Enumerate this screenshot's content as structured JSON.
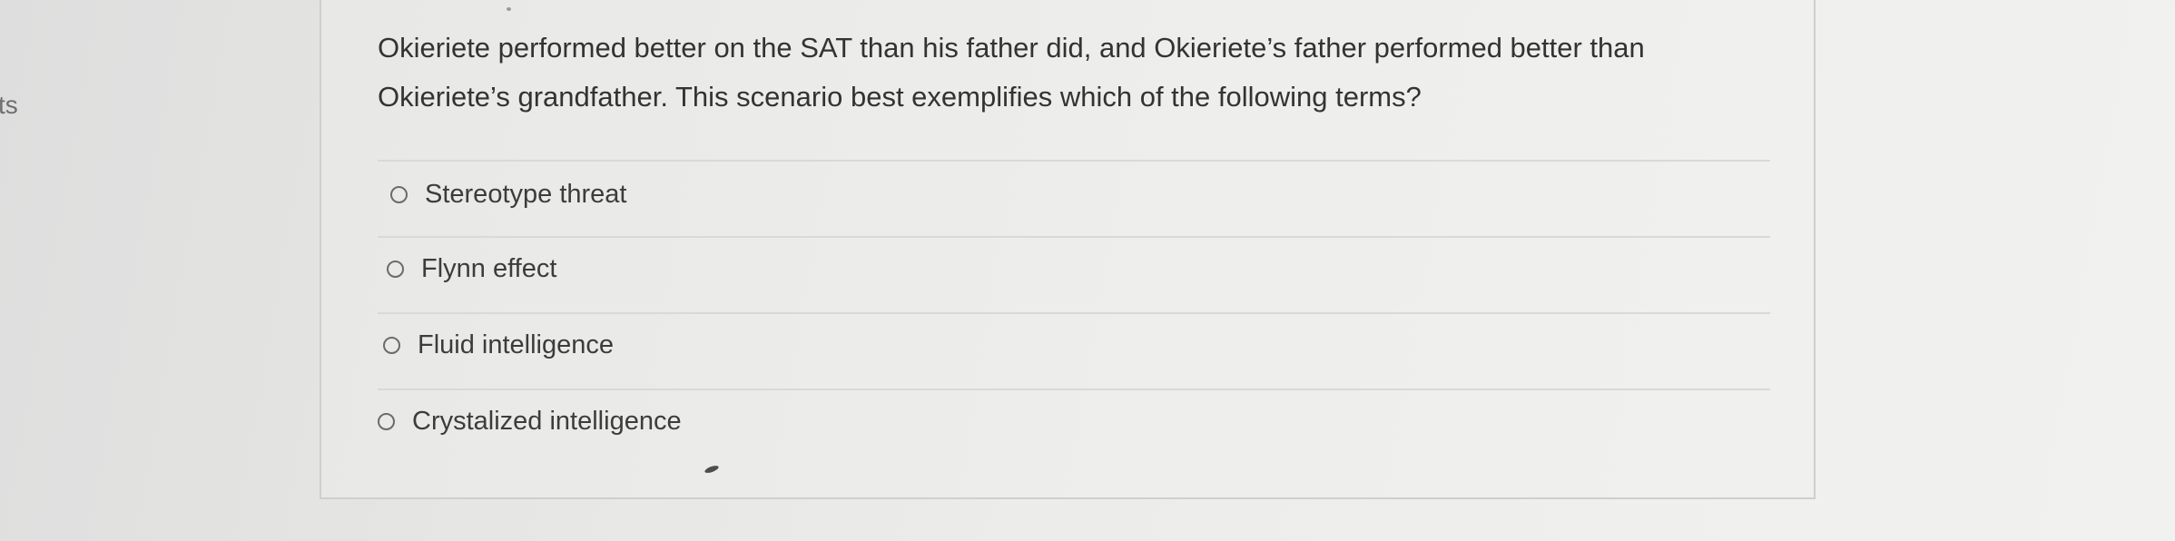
{
  "sidebar": {
    "cut_off_label": "ts"
  },
  "question": {
    "text": "Okieriete performed better on the SAT than his father did, and Okieriete’s father performed better than Okieriete’s grandfather. This scenario best exemplifies which of the following terms?",
    "options": [
      {
        "label": "Stereotype threat",
        "selected": false
      },
      {
        "label": "Flynn effect",
        "selected": false
      },
      {
        "label": "Fluid intelligence",
        "selected": false
      },
      {
        "label": "Crystalized intelligence",
        "selected": false
      }
    ]
  }
}
